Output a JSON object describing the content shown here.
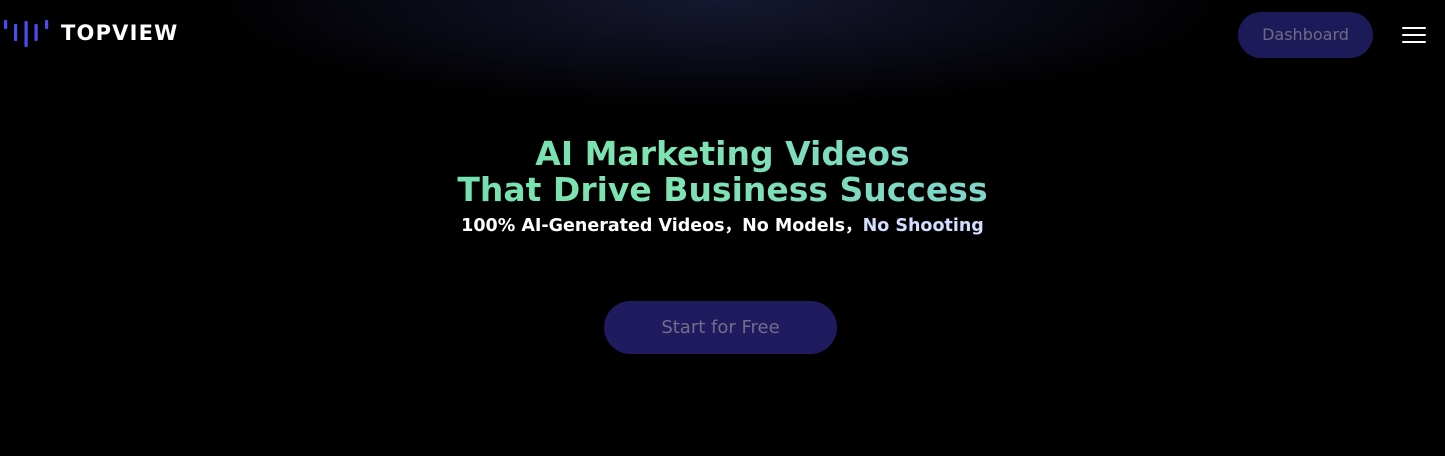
{
  "header": {
    "logo_text": "TOPVIEW",
    "dashboard_label": "Dashboard",
    "menu_icon": "hamburger-menu-icon"
  },
  "hero": {
    "title_line1": "AI Marketing Videos",
    "title_line2": "That Drive Business Success",
    "subtitle_part1": "100% AI-Generated Videos，",
    "subtitle_part2": "No Models，",
    "subtitle_part3": "No Shooting",
    "cta_label": "Start for Free"
  },
  "colors": {
    "background": "#000000",
    "logo_accent": "#4d4cf0",
    "button_bg": "#1c1a58",
    "button_text": "#6e6b86",
    "title_gradient_start": "#5cd7b0",
    "title_gradient_end": "#7ec0f0"
  }
}
